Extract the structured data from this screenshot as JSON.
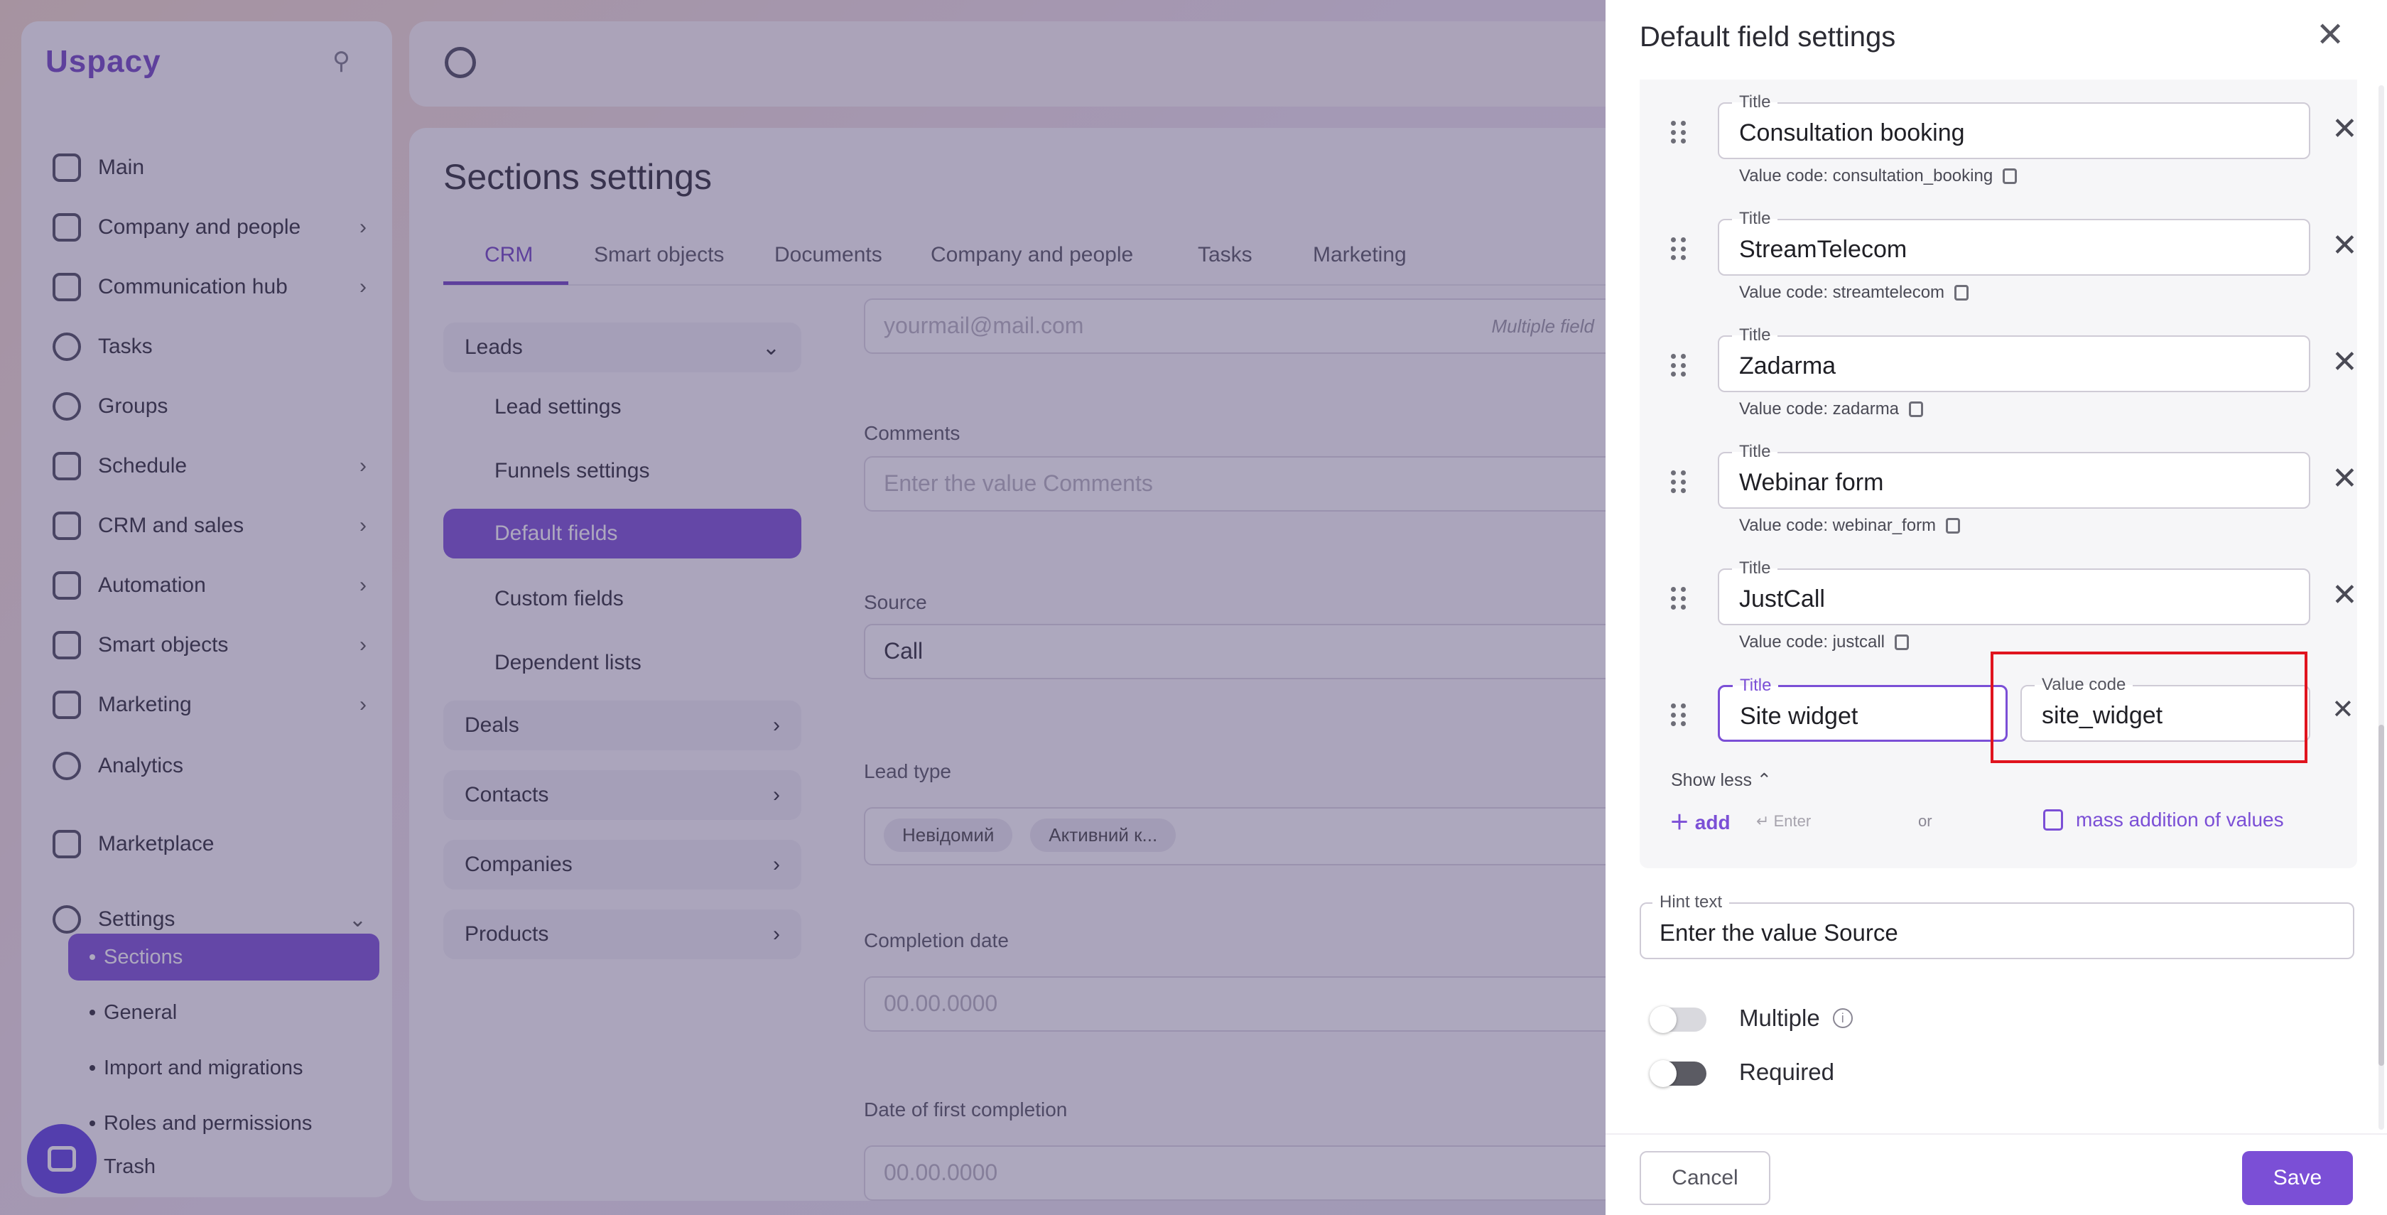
{
  "app": {
    "logo": "Uspacy",
    "sidebar": {
      "items": [
        {
          "label": "Main",
          "icon": "home-icon"
        },
        {
          "label": "Company and people",
          "icon": "company-icon",
          "chevron": true
        },
        {
          "label": "Communication hub",
          "icon": "chat-icon",
          "chevron": true
        },
        {
          "label": "Tasks",
          "icon": "check-circle-icon"
        },
        {
          "label": "Groups",
          "icon": "groups-icon"
        },
        {
          "label": "Schedule",
          "icon": "calendar-icon",
          "chevron": true
        },
        {
          "label": "CRM and sales",
          "icon": "database-icon",
          "chevron": true
        },
        {
          "label": "Automation",
          "icon": "bolt-icon",
          "chevron": true
        },
        {
          "label": "Smart objects",
          "icon": "scan-icon",
          "chevron": true
        },
        {
          "label": "Marketing",
          "icon": "marketing-icon",
          "chevron": true
        },
        {
          "label": "Analytics",
          "icon": "analytics-icon"
        },
        {
          "label": "Marketplace",
          "icon": "marketplace-icon"
        },
        {
          "label": "Settings",
          "icon": "gear-icon",
          "chevron": true
        }
      ],
      "settings_sub": [
        "Sections",
        "General",
        "Import and migrations",
        "Roles and permissions",
        "Trash"
      ]
    },
    "page_title": "Sections settings",
    "tabs": [
      "CRM",
      "Smart objects",
      "Documents",
      "Company and people",
      "Tasks",
      "Marketing"
    ],
    "sections": {
      "leads": "Leads",
      "lead_sub": [
        "Lead settings",
        "Funnels settings",
        "Default fields",
        "Custom fields",
        "Dependent lists"
      ],
      "deals": "Deals",
      "contacts": "Contacts",
      "companies": "Companies",
      "products": "Products"
    },
    "form": {
      "email_placeholder": "yourmail@mail.com",
      "multiple_field": "Multiple field",
      "comments_label": "Comments",
      "comments_placeholder": "Enter the value Comments",
      "source_label": "Source",
      "source_value": "Call",
      "lead_type_label": "Lead type",
      "lead_type_chips": [
        "Невідомий",
        "Активний к..."
      ],
      "completion_label": "Completion date",
      "completion_placeholder": "00.00.0000",
      "first_completion_label": "Date of first completion",
      "first_completion_placeholder": "00.00.0000"
    }
  },
  "drawer": {
    "title": "Default field settings",
    "title_label": "Title",
    "value_code_label": "Value code",
    "value_code_prefix": "Value code: ",
    "values": [
      {
        "title": "Consultation booking",
        "code": "consultation_booking"
      },
      {
        "title": "StreamTelecom",
        "code": "streamtelecom"
      },
      {
        "title": "Zadarma",
        "code": "zadarma"
      },
      {
        "title": "Webinar form",
        "code": "webinar_form"
      },
      {
        "title": "JustCall",
        "code": "justcall"
      }
    ],
    "editing": {
      "title": "Site widget",
      "code": "site_widget"
    },
    "show_less": "Show less",
    "add": "add",
    "enter_hint": "Enter",
    "or": "or",
    "mass_addition": "mass addition of values",
    "hint_text_label": "Hint text",
    "hint_text_value": "Enter the value Source",
    "multiple_label": "Multiple",
    "required_label": "Required",
    "cancel": "Cancel",
    "save": "Save"
  },
  "colors": {
    "accent": "#7b4fd6",
    "highlight": "#e0141e",
    "overlay": "#4a3e6e"
  }
}
